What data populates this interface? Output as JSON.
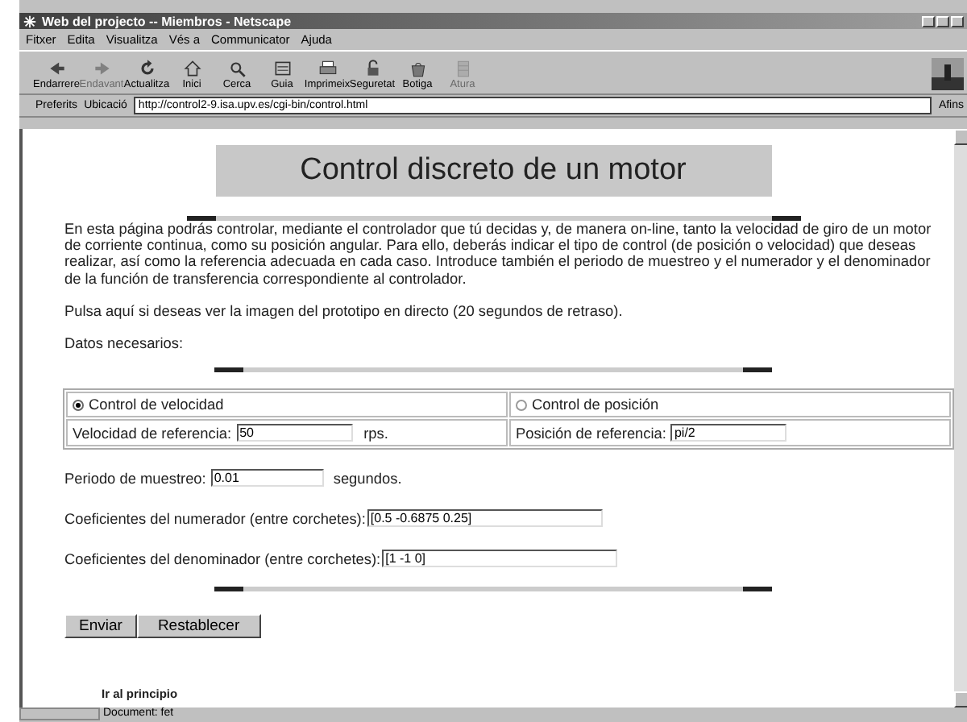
{
  "window": {
    "title": "Web del projecto -- Miembros - Netscape"
  },
  "menu": [
    "Fitxer",
    "Edita",
    "Visualitza",
    "Vés a",
    "Communicator",
    "Ajuda"
  ],
  "toolbar": [
    {
      "label": "Endarrere",
      "disabled": false
    },
    {
      "label": "Endavant",
      "disabled": true
    },
    {
      "label": "Actualitza",
      "disabled": false
    },
    {
      "label": "Inici",
      "disabled": false
    },
    {
      "label": "Cerca",
      "disabled": false
    },
    {
      "label": "Guia",
      "disabled": false
    },
    {
      "label": "Imprimeix",
      "disabled": false
    },
    {
      "label": "Seguretat",
      "disabled": false
    },
    {
      "label": "Botiga",
      "disabled": false
    },
    {
      "label": "Atura",
      "disabled": true
    }
  ],
  "location": {
    "bookmarks": "Preferits",
    "label": "Ubicació",
    "url": "http://control2-9.isa.upv.es/cgi-bin/control.html",
    "related": "Afins"
  },
  "page": {
    "heading": "Control discreto de un motor",
    "intro": "En esta página podrás controlar, mediante el controlador que tú decidas y, de manera on-line, tanto la velocidad de giro de un motor de corriente continua, como su posición angular. Para ello, deberás indicar el tipo de control (de posición o velocidad) que deseas realizar, así como la referencia adecuada en cada caso. Introduce también el periodo de muestreo y el numerador y el denominador de la función de transferencia correspondiente al controlador.",
    "live_link": "Pulsa aquí si deseas ver la imagen del prototipo en directo (20 segundos de retraso).",
    "data_label": "Datos necesarios:",
    "control_options": [
      {
        "label": "Control de velocidad",
        "selected": true
      },
      {
        "label": "Control de posición",
        "selected": false
      }
    ],
    "references": [
      {
        "label": "Velocidad de referencia:",
        "value": "50",
        "unit": "rps."
      },
      {
        "label": "Posición de referencia:",
        "value": "pi/2"
      }
    ],
    "sampling": {
      "label": "Periodo de muestreo:",
      "value": "0.01",
      "unit": "segundos."
    },
    "numerator": {
      "label": "Coeficientes del numerador (entre corchetes):",
      "value": "[0.5 -0.6875 0.25]"
    },
    "denominator": {
      "label": "Coeficientes del denominador (entre corchetes):",
      "value": "[1 -1 0]"
    },
    "buttons": [
      "Enviar",
      "Restablecer"
    ],
    "top_link": "Ir al principio"
  },
  "status_bar": {
    "text": "Document: fet"
  }
}
